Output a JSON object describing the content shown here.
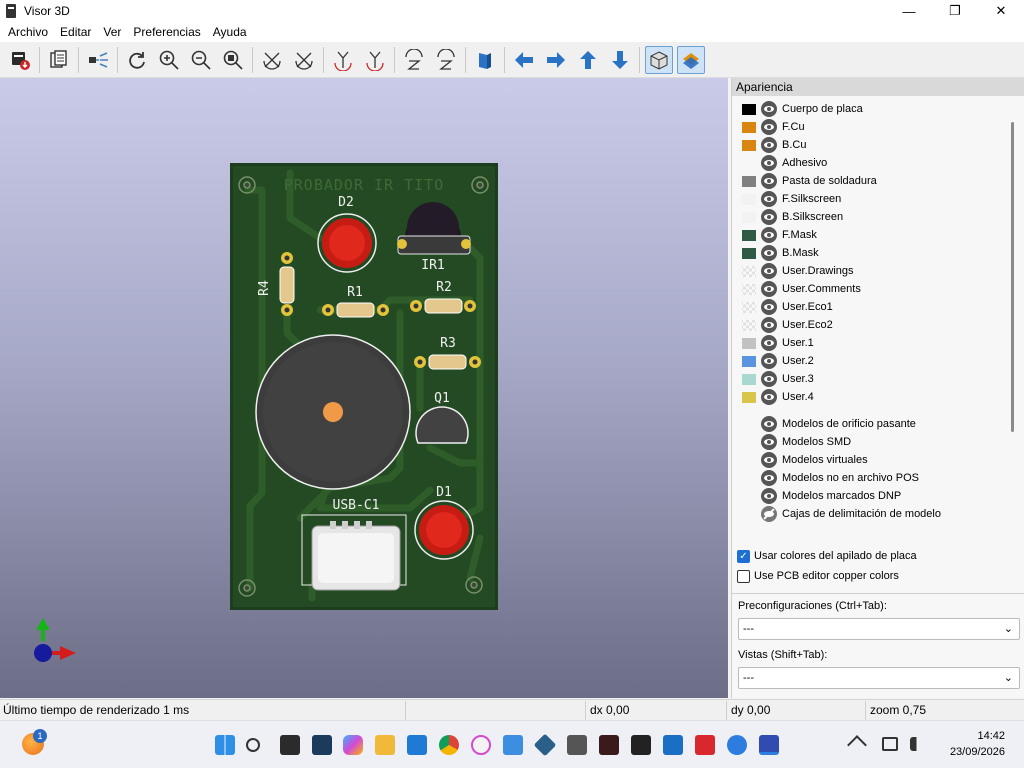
{
  "window": {
    "title": "Visor 3D",
    "minimize": "—",
    "maximize": "❐",
    "close": "✕"
  },
  "menu": [
    "Archivo",
    "Editar",
    "Ver",
    "Preferencias",
    "Ayuda"
  ],
  "toolbar_icons": [
    "render-icon",
    "copy-icon",
    "raytrace-icon",
    "reload-icon",
    "zoom-in-icon",
    "zoom-out-icon",
    "zoom-fit-icon",
    "rotate-x-cw-icon",
    "rotate-x-ccw-icon",
    "rotate-y-cw-icon",
    "rotate-y-ccw-icon",
    "rotate-z-cw-icon",
    "rotate-z-ccw-icon",
    "flip-board-icon",
    "move-left-icon",
    "move-right-icon",
    "move-up-icon",
    "move-down-icon",
    "ortho-icon",
    "layers-icon"
  ],
  "pcb": {
    "board_title": "PROBADOR IR TITO",
    "refs": {
      "d2": "D2",
      "ir1": "IR1",
      "r4": "R4",
      "r1": "R1",
      "r2": "R2",
      "r3": "R3",
      "q1": "Q1",
      "d1": "D1",
      "usb": "USB-C1"
    }
  },
  "panel": {
    "header": "Apariencia",
    "layers": [
      {
        "label": "Cuerpo de placa",
        "color": "#000000",
        "swatch": "solid"
      },
      {
        "label": "F.Cu",
        "color": "#d8860f",
        "swatch": "solid"
      },
      {
        "label": "B.Cu",
        "color": "#d8860f",
        "swatch": "solid"
      },
      {
        "label": "Adhesivo",
        "color": "",
        "swatch": "none"
      },
      {
        "label": "Pasta de soldadura",
        "color": "#808080",
        "swatch": "solid"
      },
      {
        "label": "F.Silkscreen",
        "color": "#f2f2f2",
        "swatch": "solid"
      },
      {
        "label": "B.Silkscreen",
        "color": "#f2f2f2",
        "swatch": "solid"
      },
      {
        "label": "F.Mask",
        "color": "#2f5a45",
        "swatch": "solid"
      },
      {
        "label": "B.Mask",
        "color": "#2f5a45",
        "swatch": "solid"
      },
      {
        "label": "User.Drawings",
        "color": "",
        "swatch": "checker"
      },
      {
        "label": "User.Comments",
        "color": "",
        "swatch": "checker"
      },
      {
        "label": "User.Eco1",
        "color": "",
        "swatch": "checker"
      },
      {
        "label": "User.Eco2",
        "color": "",
        "swatch": "checker"
      },
      {
        "label": "User.1",
        "color": "#c2c2c2",
        "swatch": "solid"
      },
      {
        "label": "User.2",
        "color": "#5b94de",
        "swatch": "solid"
      },
      {
        "label": "User.3",
        "color": "#a8d8cf",
        "swatch": "solid"
      },
      {
        "label": "User.4",
        "color": "#d8c54a",
        "swatch": "solid"
      }
    ],
    "models": [
      {
        "label": "Modelos de orificio pasante",
        "icon": "eye-icon"
      },
      {
        "label": "Modelos SMD",
        "icon": "eye-icon"
      },
      {
        "label": "Modelos virtuales",
        "icon": "eye-icon"
      },
      {
        "label": "Modelos no en archivo POS",
        "icon": "eye-icon"
      },
      {
        "label": "Modelos marcados DNP",
        "icon": "eye-icon"
      },
      {
        "label": "Cajas de delimitación de modelo",
        "icon": "hidden-icon"
      }
    ],
    "use_stackup_colors": "Usar colores del apilado de placa",
    "use_pcb_copper": "Use PCB editor copper colors",
    "presets_label": "Preconfiguraciones (Ctrl+Tab):",
    "presets_value": "---",
    "views_label": "Vistas (Shift+Tab):",
    "views_value": "---"
  },
  "status": {
    "render_time": "Último tiempo de renderizado 1 ms",
    "dx": "dx 0,00",
    "dy": "dy 0,00",
    "zoom": "zoom 0,75"
  },
  "taskbar": {
    "notification_count": "1",
    "time": "14:42",
    "date": "23/09/2026"
  }
}
